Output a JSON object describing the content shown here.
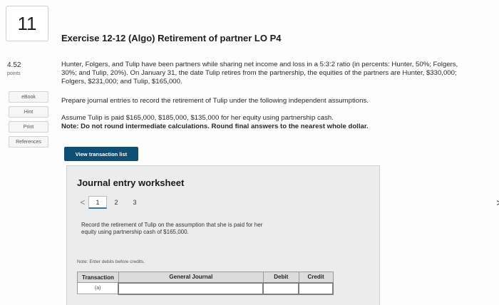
{
  "question": {
    "number": "11",
    "points_value": "4.52",
    "points_label": "points"
  },
  "sidebar": {
    "items": [
      "eBook",
      "Hint",
      "Print",
      "References"
    ]
  },
  "exercise": {
    "title": "Exercise 12-12 (Algo) Retirement of partner LO P4",
    "paragraph1_line1": "Hunter, Folgers, and Tulip have been partners while sharing net income and loss in a 5:3:2 ratio (in percents: Hunter, 50%; Folgers,",
    "paragraph1_line2": "30%; and Tulip, 20%). On January 31, the date Tulip retires from the partnership, the equities of the partners are Hunter, $330,000;",
    "paragraph1_line3": "Folgers, $231,000; and Tulip, $165,000.",
    "paragraph2": "Prepare journal entries to record the retirement of Tulip under the following independent assumptions.",
    "paragraph3": "Assume Tulip is paid $165,000, $185,000, $135,000 for her equity using partnership cash.",
    "note": "Note: Do not round intermediate calculations. Round final answers to the nearest whole dollar."
  },
  "view_transaction_button": "View transaction list",
  "worksheet": {
    "title": "Journal entry worksheet",
    "prev_arrow": "<",
    "next_arrow": ">",
    "pages": [
      "1",
      "2",
      "3"
    ],
    "instruction_line1": "Record the retirement of Tulip on the assumption that she is paid for her",
    "instruction_line2": "equity using partnership cash of $165,000.",
    "note": "Note: Enter debits before credits.",
    "columns": [
      "Transaction",
      "General Journal",
      "Debit",
      "Credit"
    ],
    "rows": [
      [
        "(a)",
        "",
        "",
        ""
      ]
    ]
  }
}
